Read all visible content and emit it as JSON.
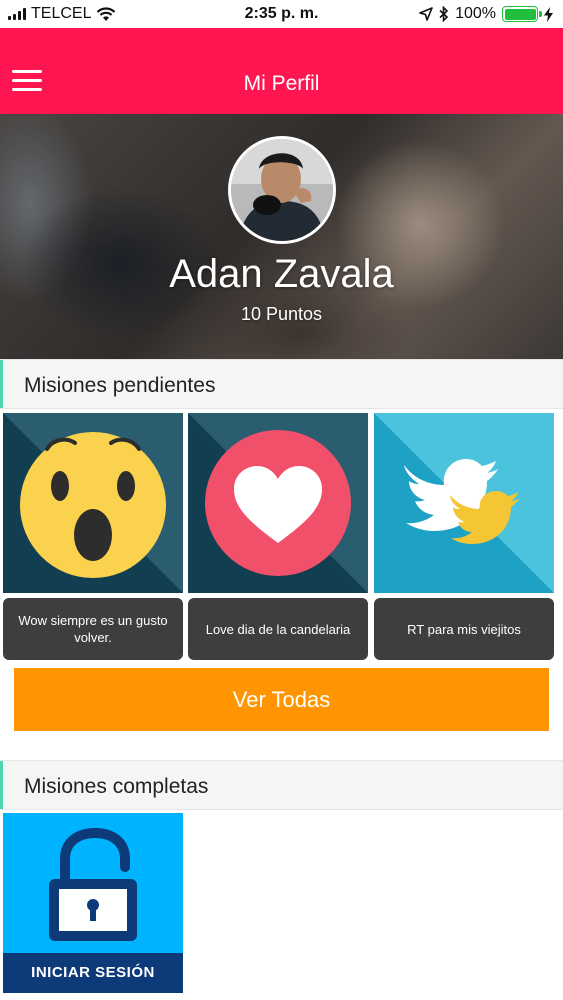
{
  "status_bar": {
    "carrier": "TELCEL",
    "time": "2:35 p. m.",
    "battery_percent": "100%",
    "battery_level": 1.0
  },
  "header": {
    "title": "Mi Perfil",
    "menu_icon": "hamburger-menu-icon"
  },
  "profile": {
    "name": "Adan Zavala",
    "points": "10 Puntos"
  },
  "pending_section": {
    "title": "Misiones pendientes",
    "missions": [
      {
        "icon": "wow-emoji-icon",
        "caption": "Wow siempre es un gusto volver."
      },
      {
        "icon": "heart-love-icon",
        "caption": "Love dia de la candelaria"
      },
      {
        "icon": "twitter-birds-icon",
        "caption": "RT para mis viejitos"
      }
    ],
    "view_all_label": "Ver Todas"
  },
  "completed_section": {
    "title": "Misiones completas",
    "missions": [
      {
        "icon": "unlocked-padlock-icon",
        "banner": "INICIAR SESIÓN"
      }
    ]
  },
  "colors": {
    "header": "#ff1650",
    "accent": "#4dd6b0",
    "button": "#ff9500",
    "caption_bg": "#3e3e3e",
    "login_tile": "#00b3ff",
    "login_banner": "#0d3a78"
  }
}
